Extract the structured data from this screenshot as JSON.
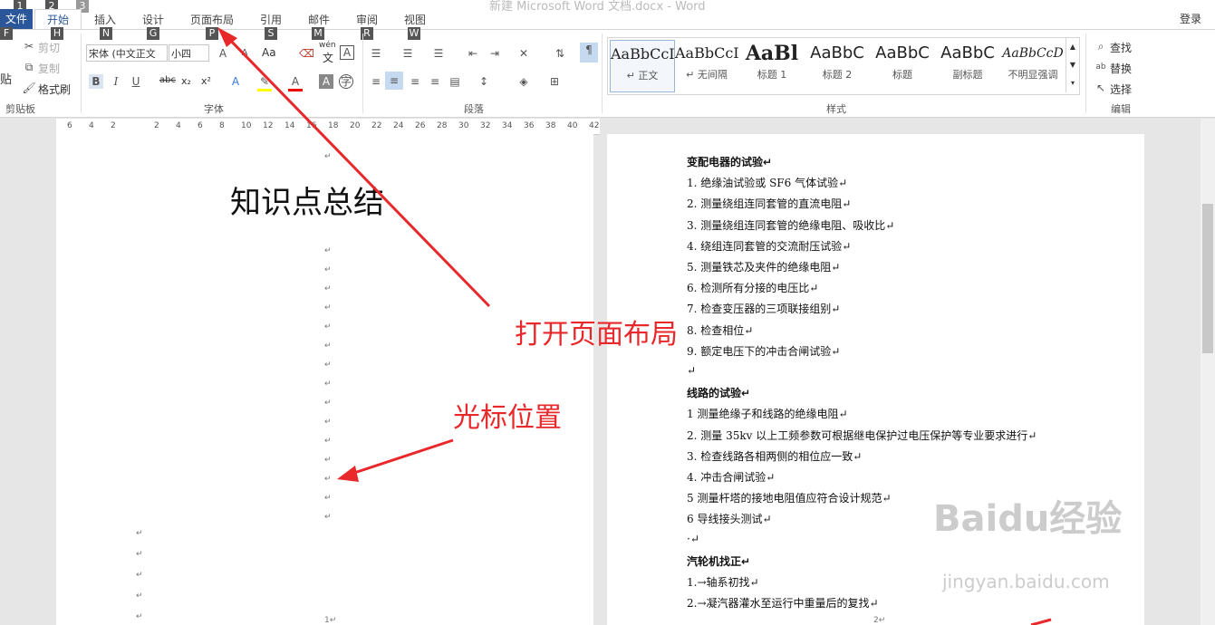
{
  "window": {
    "title": "新建 Microsoft Word 文档.docx - Word",
    "login": "登录"
  },
  "tabs": [
    {
      "label": "文件",
      "key": "F",
      "num": "1"
    },
    {
      "label": "开始",
      "key": "H",
      "num": "2"
    },
    {
      "label": "插入",
      "key": "N",
      "num": "3"
    },
    {
      "label": "设计",
      "key": "G"
    },
    {
      "label": "页面布局",
      "key": "P"
    },
    {
      "label": "引用",
      "key": "S"
    },
    {
      "label": "邮件",
      "key": "M"
    },
    {
      "label": "审阅",
      "key": "R"
    },
    {
      "label": "视图",
      "key": "W"
    }
  ],
  "clipboard": {
    "paste": "贴",
    "cut": "剪切",
    "copy": "复制",
    "format_painter": "格式刷",
    "label": "剪贴板"
  },
  "font": {
    "name": "宋体 (中文正文",
    "size": "小四",
    "label": "字体",
    "wen": "wén",
    "wen_char": "文",
    "aa": "Aa",
    "bold": "B",
    "italic": "I",
    "underline": "U",
    "strike": "abc",
    "sub": "x₂",
    "sup": "x²"
  },
  "paragraph": {
    "label": "段落"
  },
  "styles": {
    "label": "样式",
    "items": [
      {
        "sample": "AaBbCcI",
        "name": "↵ 正文"
      },
      {
        "sample": "AaBbCcI",
        "name": "↵ 无间隔"
      },
      {
        "sample": "AaBl",
        "name": "标题 1"
      },
      {
        "sample": "AaBbC",
        "name": "标题 2"
      },
      {
        "sample": "AaBbC",
        "name": "标题"
      },
      {
        "sample": "AaBbC",
        "name": "副标题"
      },
      {
        "sample": "AaBbCcD",
        "name": "不明显强调"
      }
    ]
  },
  "editing": {
    "find": "查找",
    "replace": "替换",
    "select": "选择",
    "label": "编辑"
  },
  "ruler": [
    "6",
    "4",
    "2",
    "",
    "2",
    "4",
    "6",
    "8",
    "10",
    "12",
    "14",
    "16",
    "18",
    "20",
    "22",
    "24",
    "26",
    "28",
    "30",
    "32",
    "34",
    "36",
    "38",
    "40",
    "42"
  ],
  "page1": {
    "title": "知识点总结",
    "page_no": "1↵"
  },
  "page2": {
    "page_no": "2↵",
    "lines": [
      {
        "text": "变配电器的试验↵",
        "bold": true
      },
      {
        "text": "1. 绝缘油试验或 SF6 气体试验↵"
      },
      {
        "text": "2. 测量绕组连同套管的直流电阻↵"
      },
      {
        "text": "3. 测量绕组连同套管的绝缘电阻、吸收比↵"
      },
      {
        "text": "4. 绕组连同套管的交流耐压试验↵"
      },
      {
        "text": "5. 测量铁芯及夹件的绝缘电阻↵"
      },
      {
        "text": "6. 检测所有分接的电压比↵"
      },
      {
        "text": "7. 检查变压器的三项联接组别↵"
      },
      {
        "text": "8. 检查相位↵"
      },
      {
        "text": "9. 额定电压下的冲击合闸试验↵"
      },
      {
        "text": "↵"
      },
      {
        "text": "线路的试验↵",
        "bold": true
      },
      {
        "text": "1 测量绝缘子和线路的绝缘电阻↵"
      },
      {
        "text": "2. 测量 35kv 以上工频参数可根据继电保护过电压保护等专业要求进行↵"
      },
      {
        "text": "3. 检查线路各相两侧的相位应一致↵"
      },
      {
        "text": "4. 冲击合闸试验↵"
      },
      {
        "text": "5 测量杆塔的接地电阻值应符合设计规范↵"
      },
      {
        "text": "6 导线接头测试↵"
      },
      {
        "text": "·↵"
      },
      {
        "text": "汽轮机找正↵",
        "bold": true
      },
      {
        "text": "1.→轴系初找↵"
      },
      {
        "text": "2.→凝汽器灌水至运行中重量后的复找↵"
      }
    ]
  },
  "annotations": {
    "open_layout": "打开页面布局",
    "cursor_pos": "光标位置"
  },
  "watermark": {
    "brand": "Baidu经验",
    "url": "jingyan.baidu.com"
  },
  "colors": {
    "accent": "#2b579a",
    "annotation": "#e8282a"
  }
}
